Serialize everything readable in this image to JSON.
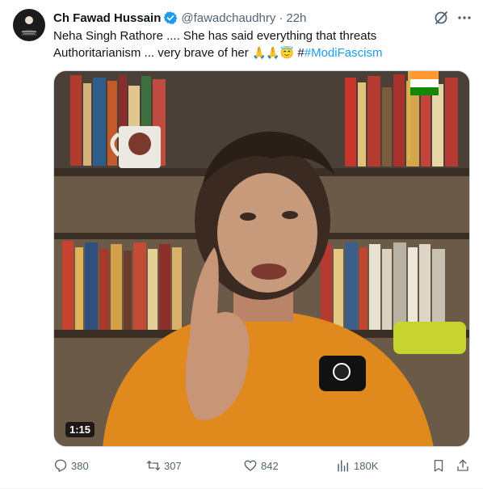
{
  "tweet": {
    "author_name": "Ch Fawad Hussain",
    "handle": "@fawadchaudhry",
    "separator": "·",
    "time": "22h",
    "text_line1": "Neha Singh Rathore .... She has said everything that threats",
    "text_line2": "Authoritarianism ... very brave of her",
    "emojis": "🙏🙏😇",
    "hash_prefix": "#",
    "hashtag": "#ModiFascism"
  },
  "media": {
    "duration": "1:15"
  },
  "actions": {
    "replies": "380",
    "reposts": "307",
    "likes": "842",
    "views": "180K"
  },
  "colors": {
    "accent": "#1d9bf0",
    "secondary_text": "#536471",
    "primary_text": "#0f1419"
  },
  "icons": [
    "verified-badge-icon",
    "grok-icon",
    "more-icon",
    "reply-icon",
    "repost-icon",
    "like-icon",
    "views-icon",
    "bookmark-icon",
    "share-icon",
    "play-icon"
  ]
}
